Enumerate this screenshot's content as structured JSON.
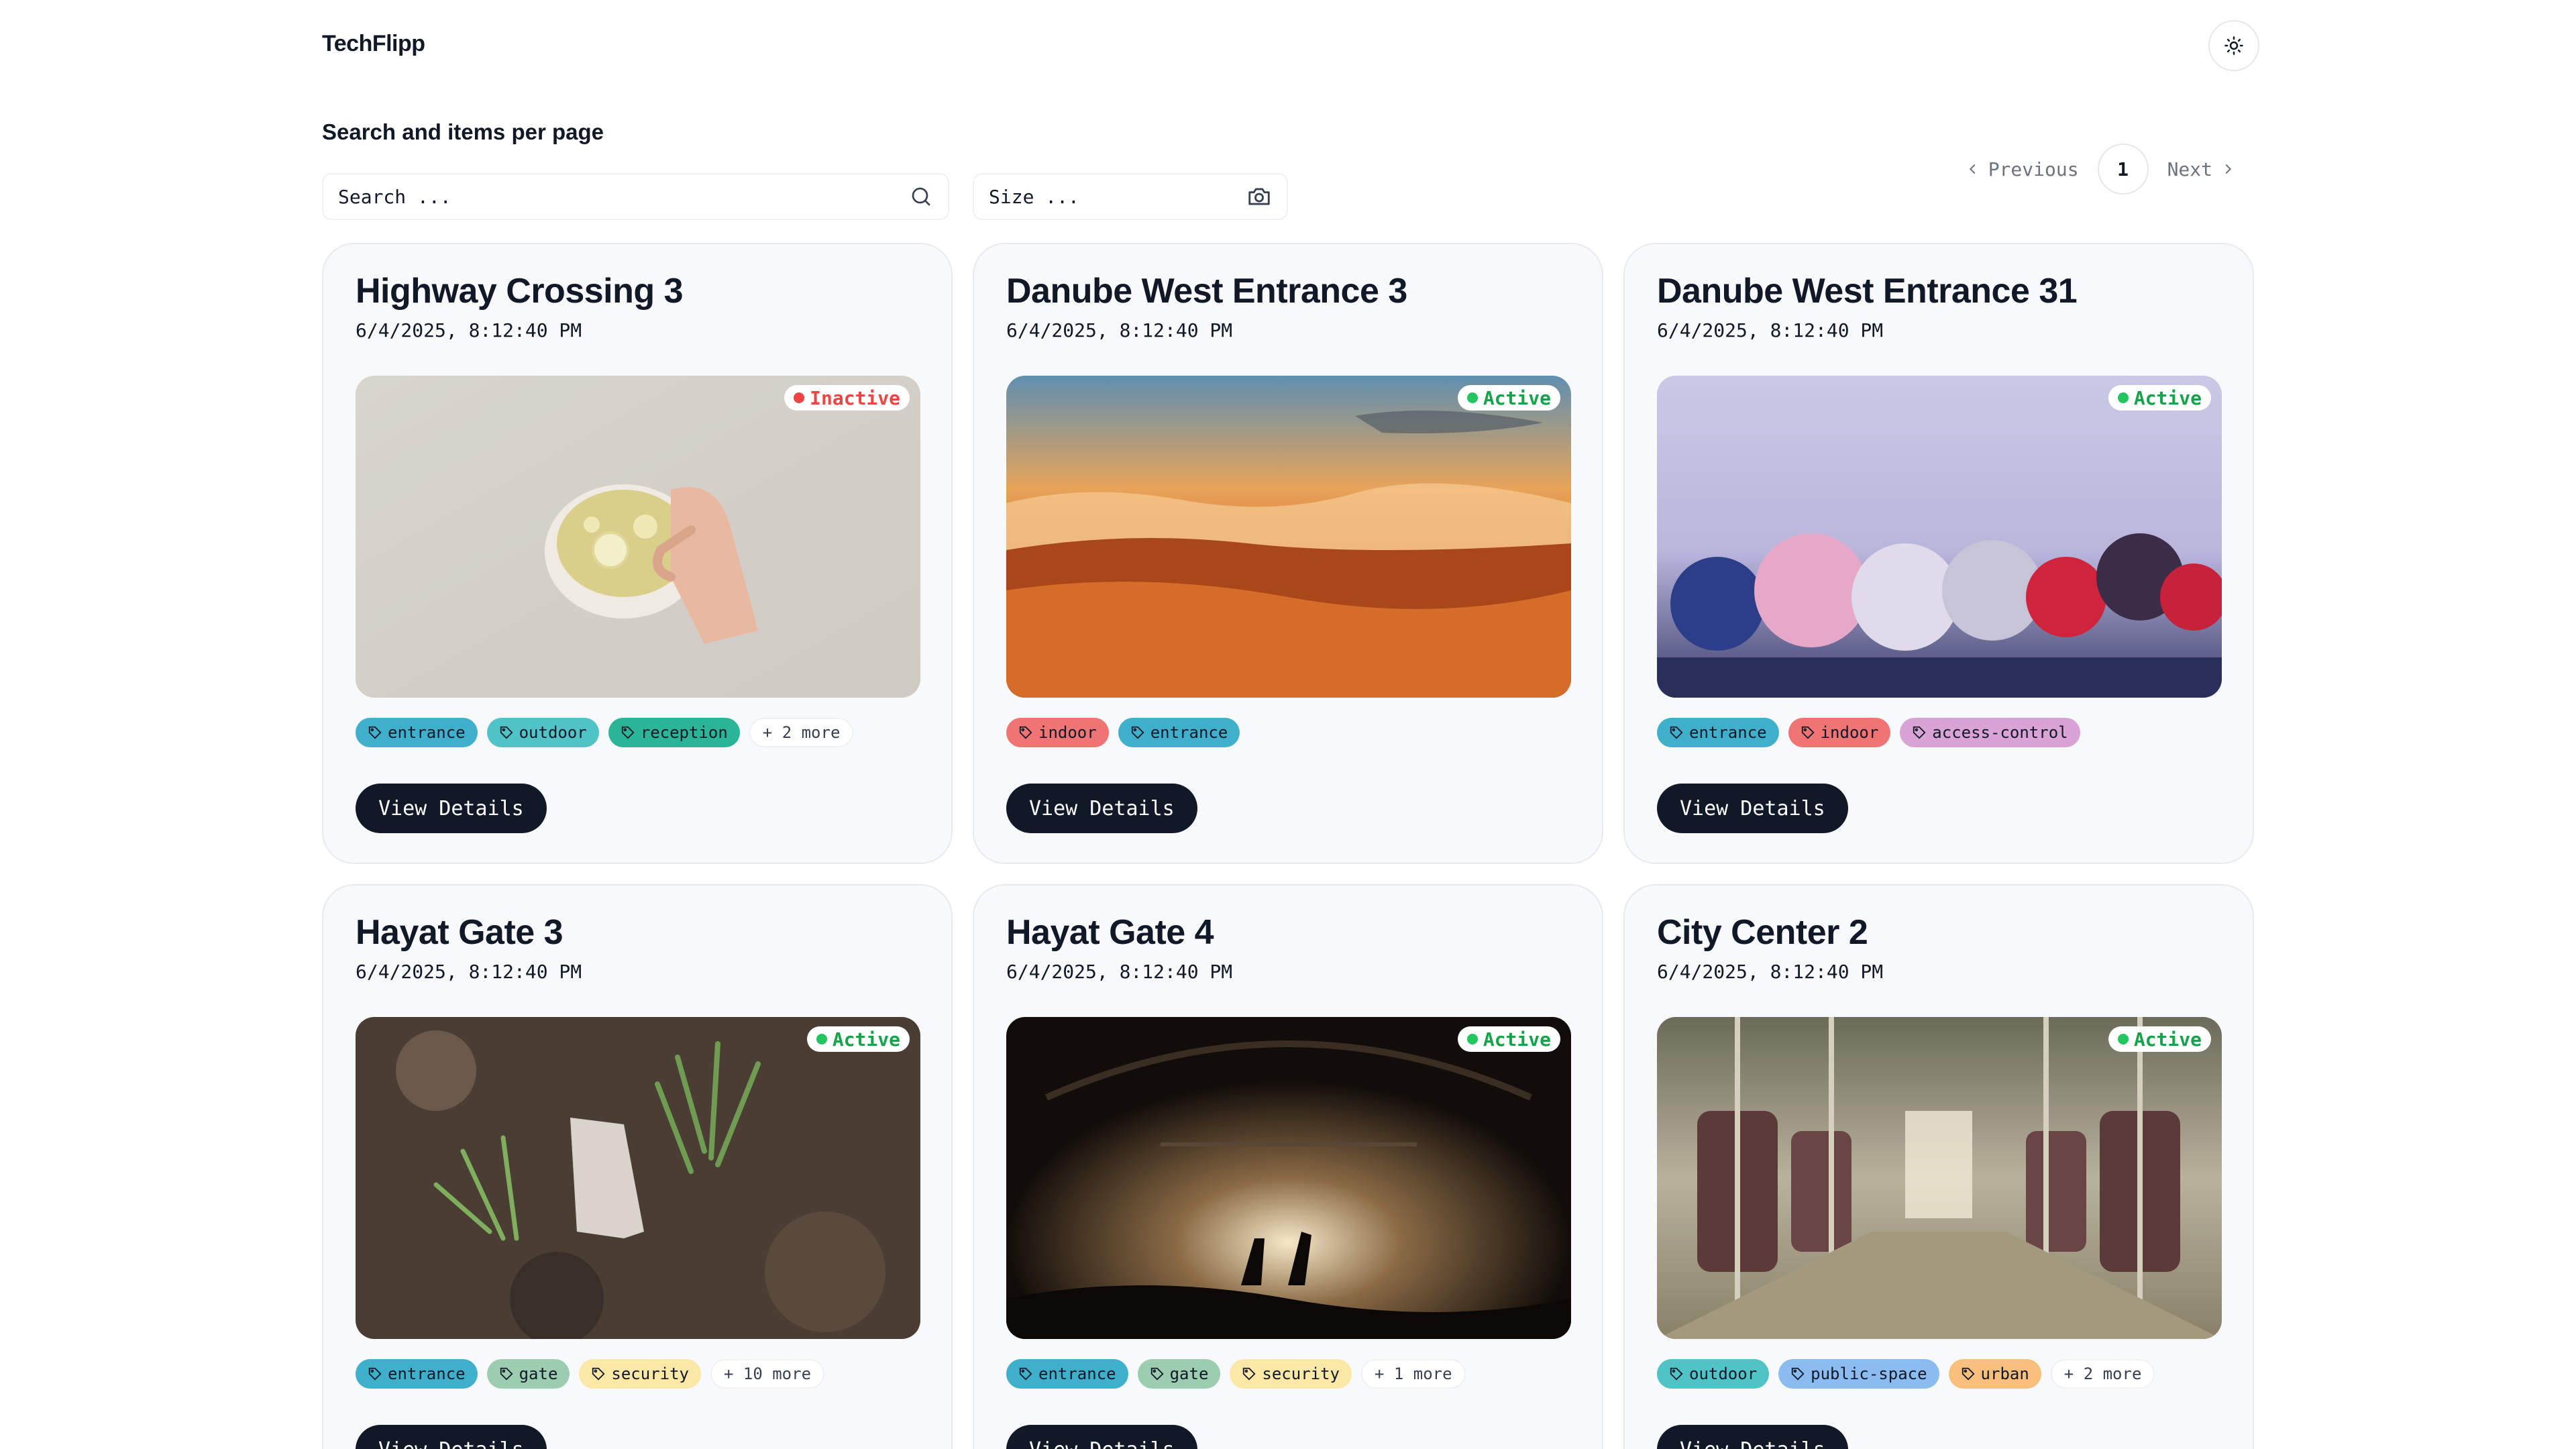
{
  "app": {
    "brand": "TechFlipp"
  },
  "section": {
    "label": "Search and items per page"
  },
  "search": {
    "placeholder": "Search ..."
  },
  "size": {
    "placeholder": "Size ..."
  },
  "pagination": {
    "previous": "Previous",
    "current": "1",
    "next": "Next"
  },
  "colors": {
    "entrance": "#3fb0cc",
    "outdoor": "#4fc3c5",
    "reception": "#2bb598",
    "indoor": "#f17474",
    "access-control": "#d9a3d6",
    "gate": "#9ccdb0",
    "security": "#fbe7a6",
    "public-space": "#8bbcef",
    "urban": "#f8c07c",
    "active": "#22c55e",
    "inactive": "#ef4444"
  },
  "cards": [
    {
      "title": "Highway Crossing 3",
      "date": "6/4/2025, 8:12:40 PM",
      "status": "Inactive",
      "image": "lemon-tea",
      "tags": [
        "entrance",
        "outdoor",
        "reception"
      ],
      "more": "+ 2 more",
      "button": "View Details"
    },
    {
      "title": "Danube West Entrance 3",
      "date": "6/4/2025, 8:12:40 PM",
      "status": "Active",
      "image": "sunset-clouds",
      "tags": [
        "indoor",
        "entrance"
      ],
      "more": "",
      "button": "View Details"
    },
    {
      "title": "Danube West Entrance 31",
      "date": "6/4/2025, 8:12:40 PM",
      "status": "Active",
      "image": "frozen-berries",
      "tags": [
        "entrance",
        "indoor",
        "access-control"
      ],
      "more": "",
      "button": "View Details"
    },
    {
      "title": "Hayat Gate 3",
      "date": "6/4/2025, 8:12:40 PM",
      "status": "Active",
      "image": "rock-grass",
      "tags": [
        "entrance",
        "gate",
        "security"
      ],
      "more": "+ 10 more",
      "button": "View Details"
    },
    {
      "title": "Hayat Gate 4",
      "date": "6/4/2025, 8:12:40 PM",
      "status": "Active",
      "image": "concert-stage",
      "tags": [
        "entrance",
        "gate",
        "security"
      ],
      "more": "+ 1 more",
      "button": "View Details"
    },
    {
      "title": "City Center 2",
      "date": "6/4/2025, 8:12:40 PM",
      "status": "Active",
      "image": "bus-interior",
      "tags": [
        "outdoor",
        "public-space",
        "urban"
      ],
      "more": "+ 2 more",
      "button": "View Details"
    }
  ]
}
